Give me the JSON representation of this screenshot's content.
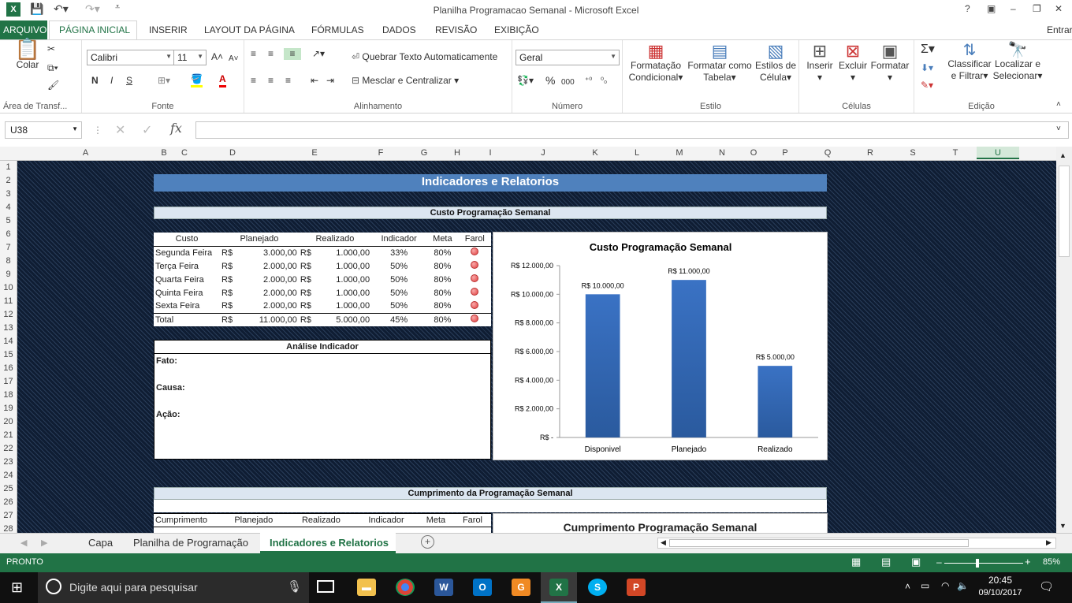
{
  "window": {
    "title": "Planilha Programacao Semanal - Microsoft Excel",
    "controls": [
      "?",
      "▣",
      "–",
      "❐",
      "✕"
    ]
  },
  "ribbon_tabs": [
    "ARQUIVO",
    "PÁGINA INICIAL",
    "INSERIR",
    "LAYOUT DA PÁGINA",
    "FÓRMULAS",
    "DADOS",
    "REVISÃO",
    "EXIBIÇÃO"
  ],
  "user": "Entrar",
  "ribbon": {
    "clipboard": {
      "paste": "Colar",
      "label": "Área de Transf..."
    },
    "font": {
      "name": "Calibri",
      "size": "11",
      "bold": "N",
      "italic": "I",
      "underline": "S",
      "label": "Fonte"
    },
    "alignment": {
      "wrap": "Quebrar Texto Automaticamente",
      "merge": "Mesclar e Centralizar",
      "label": "Alinhamento"
    },
    "number": {
      "format": "Geral",
      "label": "Número"
    },
    "styles": {
      "cond": [
        "Formatação",
        "Condicional"
      ],
      "table": [
        "Formatar como",
        "Tabela"
      ],
      "cell": [
        "Estilos de",
        "Célula"
      ],
      "label": "Estilo"
    },
    "cells": {
      "insert": "Inserir",
      "delete": "Excluir",
      "format": "Formatar",
      "label": "Células"
    },
    "editing": {
      "sort": [
        "Classificar",
        "e Filtrar"
      ],
      "find": [
        "Localizar e",
        "Selecionar"
      ],
      "label": "Edição"
    }
  },
  "formula": {
    "namebox": "U38",
    "fx": "fx",
    "value": ""
  },
  "columns": [
    "A",
    "B",
    "C",
    "D",
    "E",
    "F",
    "G",
    "H",
    "I",
    "J",
    "K",
    "L",
    "M",
    "N",
    "O",
    "P",
    "Q",
    "R",
    "S",
    "T",
    "U"
  ],
  "rows": [
    "1",
    "2",
    "3",
    "4",
    "5",
    "6",
    "7",
    "8",
    "9",
    "10",
    "11",
    "12",
    "13",
    "14",
    "15",
    "16",
    "17",
    "18",
    "19",
    "20",
    "21",
    "22",
    "23",
    "24",
    "25",
    "26",
    "27",
    "28"
  ],
  "sheet": {
    "main_title": "Indicadores e Relatorios",
    "section1": "Custo Programação Semanal",
    "table1": {
      "headers": [
        "Custo",
        "Planejado",
        "Realizado",
        "Indicador",
        "Meta",
        "Farol"
      ],
      "rows": [
        {
          "label": "Segunda Feira",
          "cur1": "R$",
          "plan": "3.000,00",
          "cur2": "R$",
          "real": "1.000,00",
          "ind": "33%",
          "meta": "80%"
        },
        {
          "label": "Terça Feira",
          "cur1": "R$",
          "plan": "2.000,00",
          "cur2": "R$",
          "real": "1.000,00",
          "ind": "50%",
          "meta": "80%"
        },
        {
          "label": "Quarta Feira",
          "cur1": "R$",
          "plan": "2.000,00",
          "cur2": "R$",
          "real": "1.000,00",
          "ind": "50%",
          "meta": "80%"
        },
        {
          "label": "Quinta Feira",
          "cur1": "R$",
          "plan": "2.000,00",
          "cur2": "R$",
          "real": "1.000,00",
          "ind": "50%",
          "meta": "80%"
        },
        {
          "label": "Sexta Feira",
          "cur1": "R$",
          "plan": "2.000,00",
          "cur2": "R$",
          "real": "1.000,00",
          "ind": "50%",
          "meta": "80%"
        },
        {
          "label": "Total",
          "cur1": "R$",
          "plan": "11.000,00",
          "cur2": "R$",
          "real": "5.000,00",
          "ind": "45%",
          "meta": "80%"
        }
      ]
    },
    "analysis": {
      "title": "Análise Indicador",
      "fato": "Fato:",
      "causa": "Causa:",
      "acao": "Ação:"
    },
    "section2": "Cumprimento da Programação Semanal",
    "table2": {
      "headers": [
        "Cumprimento",
        "Planejado",
        "Realizado",
        "Indicador",
        "Meta",
        "Farol"
      ]
    },
    "chart2_title": "Cumprimento Programação Semanal"
  },
  "chart_data": {
    "type": "bar",
    "title": "Custo Programação Semanal",
    "categories": [
      "Disponivel",
      "Planejado",
      "Realizado"
    ],
    "values": [
      10000,
      11000,
      5000
    ],
    "data_labels": [
      "R$ 10.000,00",
      "R$ 11.000,00",
      "R$ 5.000,00"
    ],
    "yticks": [
      "R$ -",
      "R$ 2.000,00",
      "R$ 4.000,00",
      "R$ 6.000,00",
      "R$ 8.000,00",
      "R$ 10.000,00",
      "R$ 12.000,00"
    ],
    "ylim": [
      0,
      12000
    ],
    "bar_color": "#3a72c4"
  },
  "sheet_tabs": [
    "Capa",
    "Planilha de Programação",
    "Indicadores e Relatorios"
  ],
  "status": {
    "text": "PRONTO",
    "zoom": "85%"
  },
  "taskbar": {
    "search": "Digite aqui para pesquisar",
    "time": "20:45",
    "date": "09/10/2017"
  }
}
